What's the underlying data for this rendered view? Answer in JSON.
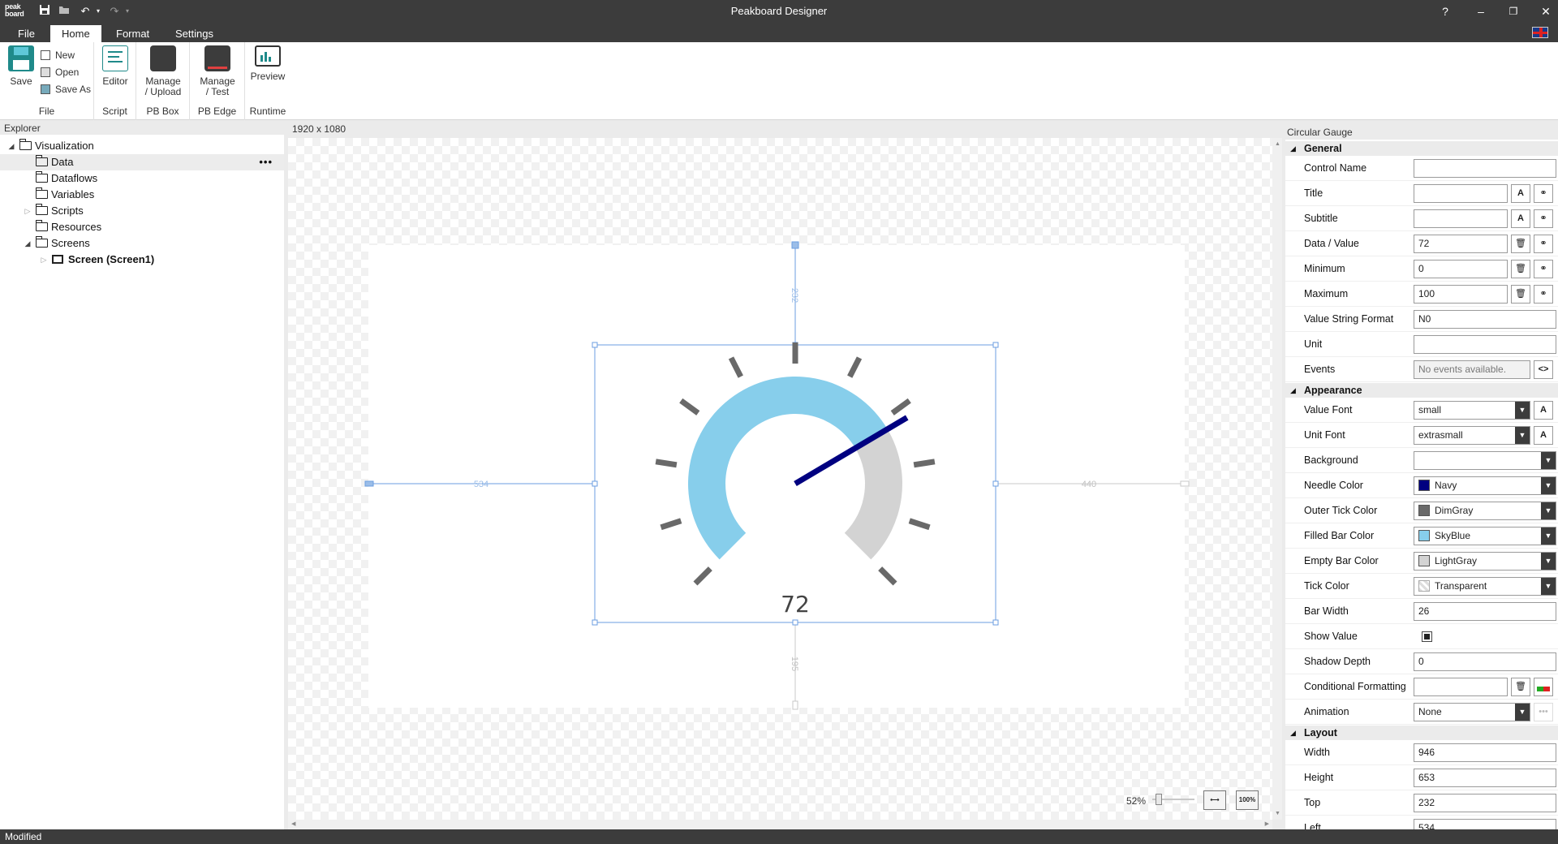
{
  "app": {
    "title": "Peakboard Designer",
    "logo_line1": "peak",
    "logo_line2": "board"
  },
  "window_controls": {
    "help": "?",
    "minimize": "–",
    "restore": "❐",
    "close": "✕"
  },
  "tabs": [
    {
      "label": "File",
      "active": false
    },
    {
      "label": "Home",
      "active": true
    },
    {
      "label": "Format",
      "active": false
    },
    {
      "label": "Settings",
      "active": false
    }
  ],
  "ribbon": {
    "file_group": {
      "label": "File",
      "save": "Save",
      "new": "New",
      "open": "Open",
      "save_as": "Save As"
    },
    "script_group": {
      "label": "Script",
      "editor": "Editor"
    },
    "pbbox_group": {
      "label": "PB Box",
      "manage_upload_1": "Manage",
      "manage_upload_2": "/ Upload"
    },
    "pbedge_group": {
      "label": "PB Edge",
      "manage_test_1": "Manage",
      "manage_test_2": "/ Test"
    },
    "runtime_group": {
      "label": "Runtime",
      "preview": "Preview"
    }
  },
  "explorer": {
    "header": "Explorer",
    "items": [
      {
        "label": "Visualization"
      },
      {
        "label": "Data"
      },
      {
        "label": "Dataflows"
      },
      {
        "label": "Variables"
      },
      {
        "label": "Scripts"
      },
      {
        "label": "Resources"
      },
      {
        "label": "Screens"
      },
      {
        "label": "Screen (Screen1)"
      }
    ],
    "more": "•••"
  },
  "canvas": {
    "resolution": "1920 x 1080",
    "dim_top": "232",
    "dim_left": "534",
    "dim_right": "440",
    "dim_bottom": "195",
    "zoom_label": "52%",
    "zoom_fraction": 0.1,
    "fit_btn": "⟷",
    "hundred_btn": "100%"
  },
  "gauge": {
    "value": 72,
    "display_value": "72",
    "min": 0,
    "max": 100,
    "colors": {
      "needle": "#000080",
      "tick": "#696969",
      "filled": "#87CEEB",
      "empty": "#D3D3D3",
      "value_text": "#444444"
    }
  },
  "properties": {
    "header": "Circular Gauge",
    "sections": {
      "general": "General",
      "appearance": "Appearance",
      "layout": "Layout"
    },
    "control_name": {
      "label": "Control Name",
      "value": ""
    },
    "title": {
      "label": "Title",
      "value": ""
    },
    "subtitle": {
      "label": "Subtitle",
      "value": ""
    },
    "data_value": {
      "label": "Data / Value",
      "value": "72"
    },
    "minimum": {
      "label": "Minimum",
      "value": "0"
    },
    "maximum": {
      "label": "Maximum",
      "value": "100"
    },
    "value_string_format": {
      "label": "Value String Format",
      "value": "N0"
    },
    "unit": {
      "label": "Unit",
      "value": ""
    },
    "events": {
      "label": "Events",
      "value": "No events available.",
      "btn": "<>"
    },
    "value_font": {
      "label": "Value Font",
      "value": "small"
    },
    "unit_font": {
      "label": "Unit Font",
      "value": "extrasmall"
    },
    "background": {
      "label": "Background",
      "value": ""
    },
    "needle_color": {
      "label": "Needle Color",
      "value": "Navy",
      "color": "#000080"
    },
    "outer_tick_color": {
      "label": "Outer Tick Color",
      "value": "DimGray",
      "color": "#696969"
    },
    "filled_bar_color": {
      "label": "Filled Bar Color",
      "value": "SkyBlue",
      "color": "#87CEEB"
    },
    "empty_bar_color": {
      "label": "Empty Bar Color",
      "value": "LightGray",
      "color": "#D3D3D3"
    },
    "tick_color": {
      "label": "Tick Color",
      "value": "Transparent",
      "color": "transparent"
    },
    "bar_width": {
      "label": "Bar Width",
      "value": "26"
    },
    "show_value": {
      "label": "Show Value",
      "checked": true
    },
    "shadow_depth": {
      "label": "Shadow Depth",
      "value": "0"
    },
    "conditional_formatting": {
      "label": "Conditional Formatting",
      "value": ""
    },
    "animation": {
      "label": "Animation",
      "value": "None",
      "btn": "•••"
    },
    "width": {
      "label": "Width",
      "value": "946"
    },
    "height": {
      "label": "Height",
      "value": "653"
    },
    "top": {
      "label": "Top",
      "value": "232"
    },
    "left": {
      "label": "Left",
      "value": "534"
    }
  },
  "status": {
    "text": "Modified"
  }
}
